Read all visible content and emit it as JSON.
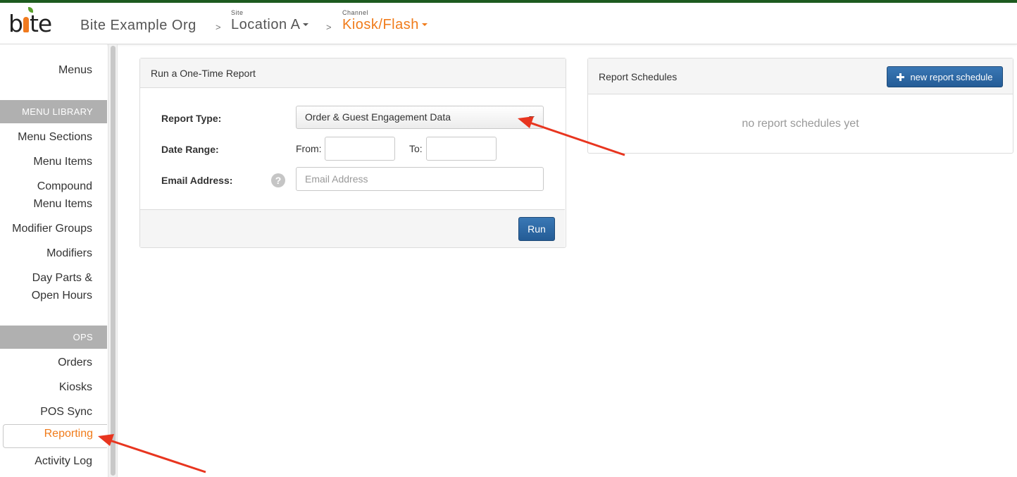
{
  "header": {
    "logo_text": "bite",
    "org": "Bite Example Org",
    "separator": ">",
    "site_caption": "Site",
    "site": "Location A",
    "channel_caption": "Channel",
    "channel": "Kiosk/Flash"
  },
  "sidebar": {
    "menus": "Menus",
    "menu_library_header": "MENU LIBRARY",
    "menu_sections": "Menu Sections",
    "menu_items": "Menu Items",
    "compound_line1": "Compound",
    "compound_line2": "Menu Items",
    "modifier_groups": "Modifier Groups",
    "modifiers": "Modifiers",
    "dayparts_line1": "Day Parts &",
    "dayparts_line2": "Open Hours",
    "ops_header": "OPS",
    "orders": "Orders",
    "kiosks": "Kiosks",
    "pos_sync": "POS Sync",
    "reporting": "Reporting",
    "activity_log": "Activity Log"
  },
  "one_time_report": {
    "title": "Run a One-Time Report",
    "report_type_label": "Report Type:",
    "report_type_value": "Order & Guest Engagement Data",
    "date_range_label": "Date Range:",
    "from_label": "From:",
    "to_label": "To:",
    "from_value": "",
    "to_value": "",
    "email_label": "Email Address:",
    "email_placeholder": "Email Address",
    "help_glyph": "?",
    "run_label": "Run"
  },
  "report_schedules": {
    "title": "Report Schedules",
    "new_button": "new report schedule",
    "empty_text": "no report schedules yet"
  },
  "colors": {
    "accent_orange": "#f07b1a",
    "primary_blue": "#2a639c",
    "annotation_red": "#e8351f",
    "top_border_green": "#1d5a1f"
  }
}
